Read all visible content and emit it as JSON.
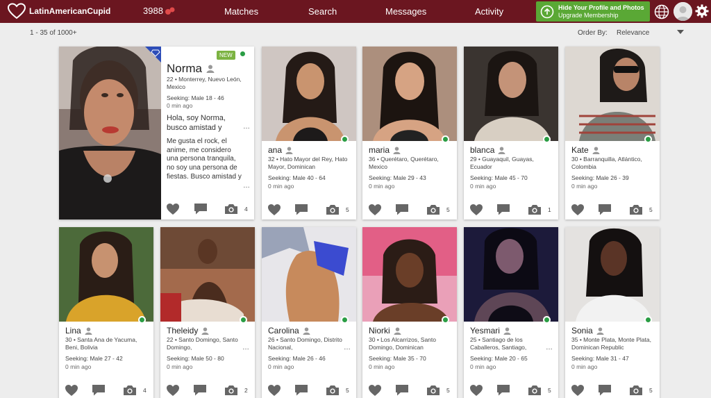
{
  "header": {
    "logo_text": "LatinAmericanCupid",
    "interest_count": "3988",
    "nav": [
      "Matches",
      "Search",
      "Messages",
      "Activity"
    ],
    "promo_line1": "Hide Your Profile and Photos",
    "promo_line2": "Upgrade Membership"
  },
  "results": {
    "count_text": "1 - 35 of 1000+",
    "order_label": "Order By:",
    "order_value": "Relevance"
  },
  "featured": {
    "badge": "NEW",
    "name": "Norma",
    "location": "22 • Monterrey, Nuevo León, Mexico",
    "seeking": "Seeking: Male 18 - 46",
    "last_active": "0 min ago",
    "headline": "Hola, soy Norma, busco amistad y",
    "about": "Me gusta el rock, el anime, me considero una persona tranquila, no soy una persona de fiestas. Busco amistad y una",
    "photo_count": "4"
  },
  "row1": [
    {
      "name": "ana",
      "location": "32 • Hato Mayor del Rey, Hato Mayor, Dominican",
      "seeking": "Seeking: Male 40 - 64",
      "last_active": "0 min ago",
      "photo_count": "5"
    },
    {
      "name": "maria",
      "location": "36 • Querétaro, Querétaro, Mexico",
      "seeking": "Seeking: Male 29 - 43",
      "last_active": "0 min ago",
      "photo_count": "5"
    },
    {
      "name": "blanca",
      "location": "29 • Guayaquil, Guayas, Ecuador",
      "seeking": "Seeking: Male 45 - 70",
      "last_active": "0 min ago",
      "photo_count": "1"
    },
    {
      "name": "Kate",
      "location": "30 • Barranquilla, Atlántico, Colombia",
      "seeking": "Seeking: Male 26 - 39",
      "last_active": "0 min ago",
      "photo_count": "5"
    }
  ],
  "row2": [
    {
      "name": "Lina",
      "location": "30 • Santa Ana de Yacuma, Beni, Bolivia",
      "seeking": "Seeking: Male 27 - 42",
      "last_active": "0 min ago",
      "photo_count": "4"
    },
    {
      "name": "Theleidy",
      "location": "22 • Santo Domingo, Santo Domingo,",
      "seeking": "Seeking: Male 50 - 80",
      "last_active": "0 min ago",
      "photo_count": "2"
    },
    {
      "name": "Carolina",
      "location": "26 • Santo Domingo, Distrito Nacional,",
      "seeking": "Seeking: Male 26 - 46",
      "last_active": "0 min ago",
      "photo_count": "5"
    },
    {
      "name": "Niorki",
      "location": "30 • Los Alcarrizos, Santo Domingo, Dominican",
      "seeking": "Seeking: Male 35 - 70",
      "last_active": "0 min ago",
      "photo_count": "5"
    },
    {
      "name": "Yesmari",
      "location": "25 • Santiago de los Caballeros, Santiago,",
      "seeking": "Seeking: Male 20 - 65",
      "last_active": "0 min ago",
      "photo_count": "5"
    },
    {
      "name": "Sonia",
      "location": "35 • Monte Plata, Monte Plata, Dominican Republic",
      "seeking": "Seeking: Male 31 - 47",
      "last_active": "0 min ago",
      "photo_count": "5"
    }
  ],
  "colors": {
    "brand": "#6b1620",
    "promo": "#5aa835",
    "online": "#2a9d44",
    "new_badge": "#7cb342"
  },
  "icons": [
    "heart-logo-icon",
    "hearts-icon",
    "upload-icon",
    "globe-icon",
    "gear-icon",
    "user-icon",
    "like-icon",
    "message-icon",
    "camera-icon",
    "verified-diamond-icon"
  ]
}
